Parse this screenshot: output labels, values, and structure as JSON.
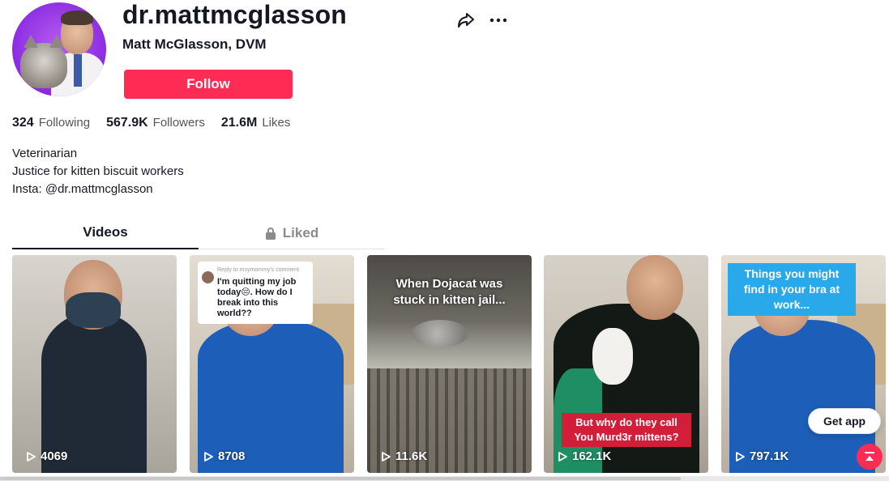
{
  "profile": {
    "username": "dr.mattmcglasson",
    "display_name": "Matt McGlasson, DVM",
    "follow_label": "Follow",
    "avatar_icon": "profile-avatar",
    "share_icon": "share-arrow-icon",
    "more_icon": "more-options-icon"
  },
  "stats": {
    "following_count": "324",
    "following_label": "Following",
    "followers_count": "567.9K",
    "followers_label": "Followers",
    "likes_count": "21.6M",
    "likes_label": "Likes"
  },
  "bio": {
    "line1": "Veterinarian",
    "line2": "Justice for kitten biscuit workers",
    "line3": "Insta: @dr.mattmcglasson"
  },
  "tabs": [
    {
      "label": "Videos",
      "active": true
    },
    {
      "label": "Liked",
      "active": false,
      "icon": "lock-icon"
    }
  ],
  "videos": [
    {
      "views": "4069"
    },
    {
      "views": "8708",
      "reply_line": "Reply to msymommy's comment",
      "caption": "I'm quitting my job today😔. How do I break into this world??"
    },
    {
      "views": "11.6K",
      "caption": "When Dojacat was stuck in kitten jail..."
    },
    {
      "views": "162.1K",
      "caption": "But why do they call You Murd3r mittens?"
    },
    {
      "views": "797.1K",
      "caption": "Things you might find in your bra at work..."
    }
  ],
  "get_app_label": "Get app",
  "colors": {
    "accent": "#fe2c55",
    "text_primary": "#161823",
    "text_secondary": "#8a8b91",
    "caption_red": "#d31e3a",
    "caption_blue": "#29a8ea"
  }
}
